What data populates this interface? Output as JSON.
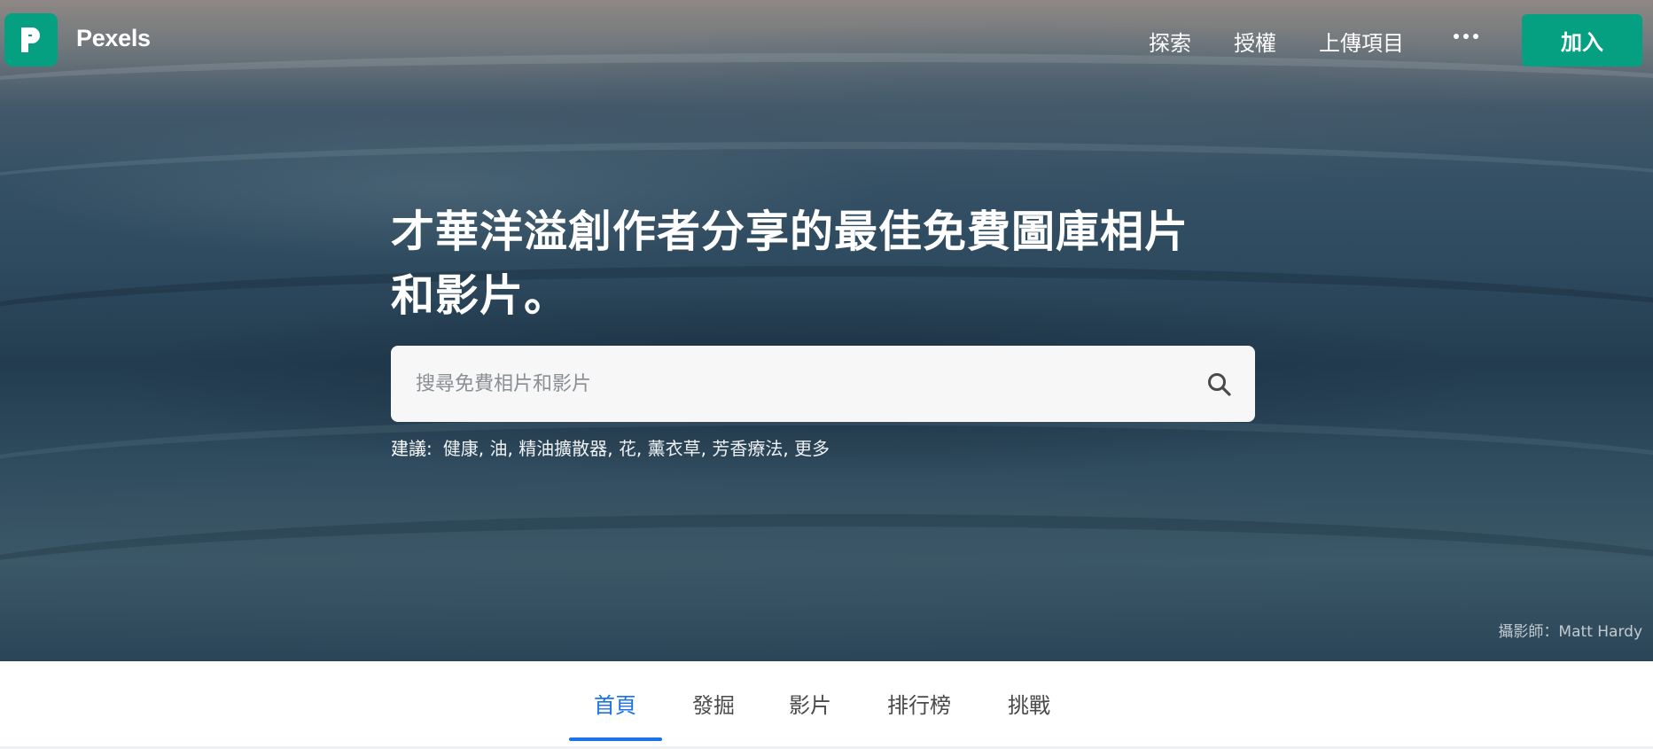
{
  "brand": {
    "name": "Pexels",
    "logo_icon": "pexels-logo-icon",
    "accent_color": "#05a081"
  },
  "nav": {
    "links": [
      "探索",
      "授權",
      "上傳項目"
    ],
    "more_icon": "ellipsis-icon",
    "join_label": "加入"
  },
  "hero": {
    "headline_line1": "才華洋溢創作者分享的最佳免費圖庫相片",
    "headline_line2": "和影片。",
    "search_placeholder": "搜尋免費相片和影片",
    "search_icon": "search-icon",
    "suggestions_label": "建議:",
    "suggestions": [
      "健康",
      "油",
      "精油擴散器",
      "花",
      "薰衣草",
      "芳香療法",
      "更多"
    ],
    "photo_credit": "攝影師：Matt Hardy"
  },
  "tabs": {
    "items": [
      "首頁",
      "發掘",
      "影片",
      "排行榜",
      "挑戰"
    ],
    "active": "首頁",
    "active_color": "#1a73e8"
  }
}
